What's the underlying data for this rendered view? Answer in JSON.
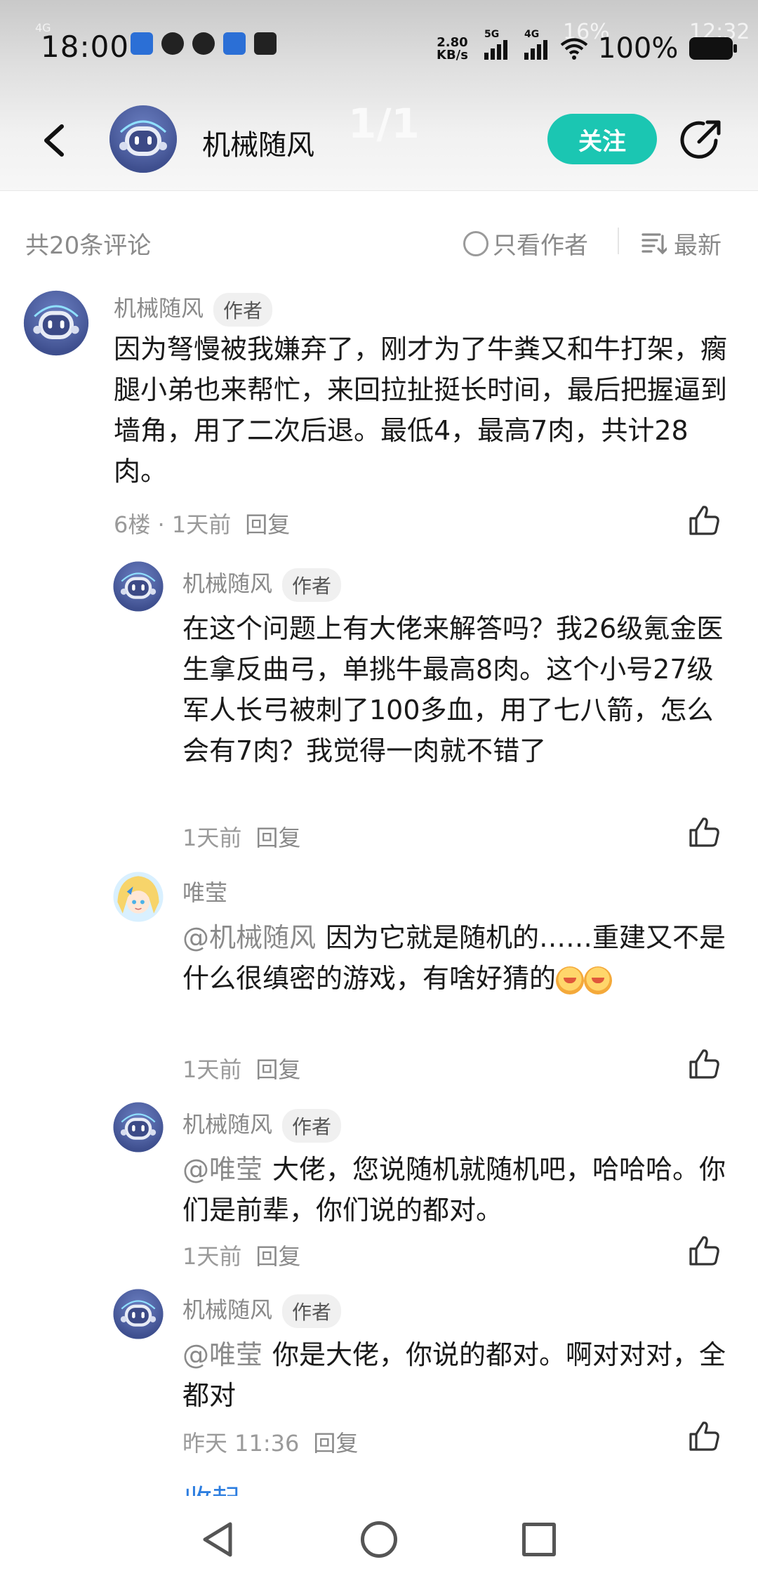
{
  "status_bar": {
    "time": "18:00",
    "net_speed": "2.80",
    "net_speed_unit": "KB/s",
    "sig1_label": "5G",
    "sig2_label": "4G",
    "battery": "100%",
    "ghost_time": "12:32",
    "ghost_pct": "16%",
    "small_label": "4G"
  },
  "header": {
    "title": "机械随风",
    "page_indicator": "1/1",
    "follow_label": "关注"
  },
  "filter": {
    "total": "共20条评论",
    "author_only": "只看作者",
    "sort": "最新"
  },
  "comments": [
    {
      "name": "机械随风",
      "tag": "作者",
      "text": "因为弩慢被我嫌弃了，刚才为了牛粪又和牛打架，瘸腿小弟也来帮忙，来回拉扯挺长时间，最后把握逼到墙角，用了二次后退。最低4，最高7肉，共计28肉。",
      "meta": "6楼 · 1天前",
      "reply": "回复"
    },
    {
      "name": "机械随风",
      "tag": "作者",
      "text": "在这个问题上有大佬来解答吗？我26级氪金医生拿反曲弓，单挑牛最高8肉。这个小号27级军人长弓被刺了100多血，用了七八箭，怎么会有7肉？我觉得一肉就不错了",
      "meta": "1天前",
      "reply": "回复"
    },
    {
      "name": "唯莹",
      "mention": "@机械随风",
      "text": "因为它就是随机的……重建又不是什么很缜密的游戏，有啥好猜的",
      "meta": "1天前",
      "reply": "回复"
    },
    {
      "name": "机械随风",
      "tag": "作者",
      "mention": "@唯莹",
      "text": "大佬，您说随机就随机吧，哈哈哈。你们是前辈，你们说的都对。",
      "meta": "1天前",
      "reply": "回复"
    },
    {
      "name": "机械随风",
      "tag": "作者",
      "mention": "@唯莹",
      "text": "你是大佬，你说的都对。啊对对对，全都对",
      "meta": "昨天 11:36",
      "reply": "回复"
    }
  ],
  "collapse_label": "收起",
  "colors": {
    "accent": "#1bc6b2",
    "link": "#2d7ee0",
    "muted": "#8a8a8a"
  },
  "icons": [
    "back-arrow-icon",
    "share-icon",
    "radio-icon",
    "sort-icon",
    "thumbs-up-icon",
    "nav-back-icon",
    "nav-home-icon",
    "nav-recent-icon"
  ]
}
